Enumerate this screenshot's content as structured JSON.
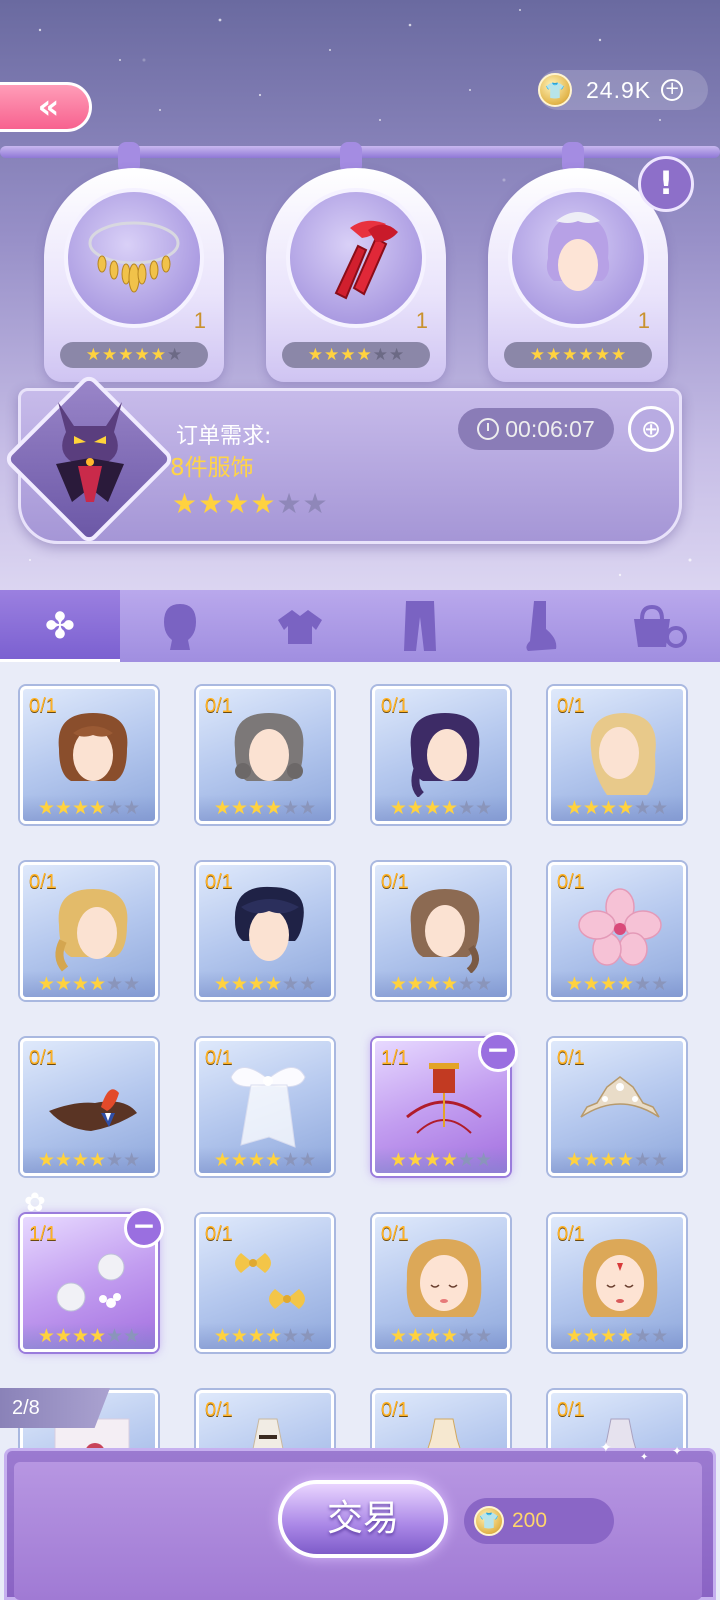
{
  "header": {
    "currency_value": "24.9K",
    "currency_icon": "shirt-coin-icon"
  },
  "featured_items": [
    {
      "name": "gold-necklace",
      "count": "1",
      "stars": 5,
      "max_stars": 6
    },
    {
      "name": "red-gloves",
      "count": "1",
      "stars": 4,
      "max_stars": 6
    },
    {
      "name": "lavender-hair",
      "count": "1",
      "stars": 6,
      "max_stars": 6
    }
  ],
  "order": {
    "label": "订单需求:",
    "requirement": "8件服饰",
    "timer": "00:06:07",
    "stars": 4,
    "max_stars": 6
  },
  "tabs": [
    {
      "name": "all",
      "icon": "clover-icon",
      "active": true
    },
    {
      "name": "hair",
      "icon": "head-icon",
      "active": false
    },
    {
      "name": "top",
      "icon": "top-icon",
      "active": false
    },
    {
      "name": "bottom",
      "icon": "pants-icon",
      "active": false
    },
    {
      "name": "shoes",
      "icon": "foot-icon",
      "active": false
    },
    {
      "name": "accessories",
      "icon": "bag-ring-icon",
      "active": false
    }
  ],
  "items": [
    {
      "count": "0/1",
      "stars": 4,
      "art": "brown-bun-hair",
      "owned": false
    },
    {
      "count": "0/1",
      "stars": 4,
      "art": "gray-curl-hair",
      "owned": false
    },
    {
      "count": "0/1",
      "stars": 4,
      "art": "purple-braid-hair",
      "owned": false
    },
    {
      "count": "0/1",
      "stars": 4,
      "art": "blonde-wave-hair",
      "owned": false
    },
    {
      "count": "0/1",
      "stars": 4,
      "art": "blonde-updo-hair",
      "owned": false
    },
    {
      "count": "0/1",
      "stars": 4,
      "art": "navy-short-hair",
      "owned": false
    },
    {
      "count": "0/1",
      "stars": 4,
      "art": "brown-low-hair",
      "owned": false
    },
    {
      "count": "0/1",
      "stars": 4,
      "art": "pink-flower",
      "owned": false
    },
    {
      "count": "0/1",
      "stars": 4,
      "art": "bicorne-hat",
      "owned": false
    },
    {
      "count": "0/1",
      "stars": 4,
      "art": "white-bow-veil",
      "owned": false
    },
    {
      "count": "1/1",
      "stars": 4,
      "art": "red-crown-headdress",
      "owned": true
    },
    {
      "count": "0/1",
      "stars": 4,
      "art": "silver-tiara",
      "owned": false
    },
    {
      "count": "1/1",
      "stars": 4,
      "art": "pearl-earrings",
      "owned": true
    },
    {
      "count": "0/1",
      "stars": 4,
      "art": "yellow-bows",
      "owned": false
    },
    {
      "count": "0/1",
      "stars": 4,
      "art": "blonde-face-a",
      "owned": false
    },
    {
      "count": "0/1",
      "stars": 4,
      "art": "blonde-face-b",
      "owned": false
    },
    {
      "count": "",
      "stars": 0,
      "art": "rose-photo",
      "owned": false
    },
    {
      "count": "0/1",
      "stars": 0,
      "art": "white-dress",
      "owned": false
    },
    {
      "count": "0/1",
      "stars": 0,
      "art": "cream-gown",
      "owned": false
    },
    {
      "count": "0/1",
      "stars": 0,
      "art": "lace-dress",
      "owned": false
    }
  ],
  "pagination": "2/8",
  "footer": {
    "trade_label": "交易",
    "cost": "200"
  },
  "colors": {
    "accent": "#8a63c4",
    "star_on": "#ffd23f",
    "count_text": "#ffb224"
  }
}
